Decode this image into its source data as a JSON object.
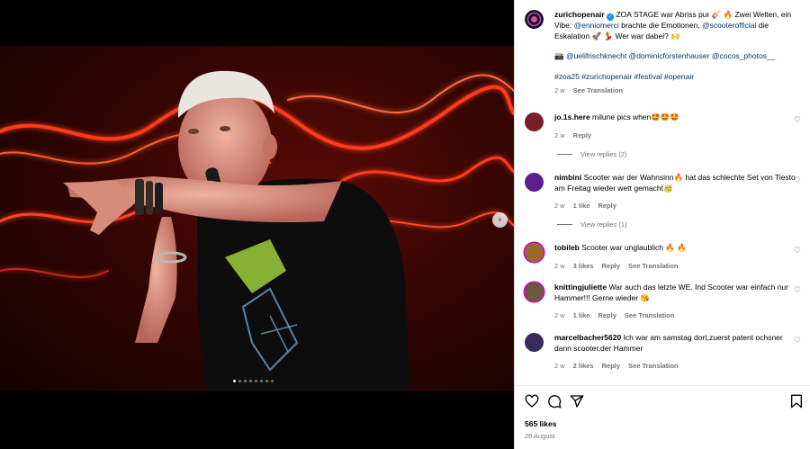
{
  "post": {
    "username": "zurichopenair",
    "verified_mark": "✓",
    "caption_parts": {
      "p1": " ZOA STAGE war Abriss pur 🎸 🔥 Zwei Welten, ein Vibe: ",
      "mention1": "@ennio​merci",
      "p2": " brachte die Emotionen, ",
      "mention2": "@scooterofficial",
      "p3": " die Eskalation 🚀 💃 Wer war dabei? 🙌"
    },
    "camera_line": "📸",
    "credits": [
      "@uelifrischknecht",
      "@dominicforstenhauser",
      "@cocos_photos__"
    ],
    "hashtags": [
      "#zoa25",
      "#zurichopenair",
      "#festival",
      "#openair"
    ],
    "time": "2 w",
    "see_translation": "See Translation"
  },
  "comments": [
    {
      "username": "jo.1s.here",
      "text": " milune pics when🤩🤩🤩",
      "time": "2 w",
      "likes": "",
      "reply": "Reply",
      "translation": "",
      "view_replies": "View replies (2)",
      "avatar_color": "#7a1d2a"
    },
    {
      "username": "nimbini",
      "text": " Scooter war der Wahnsinn🔥 hat das schlechte Set von Tiesto am Freitag wieder wett gemacht🥳",
      "time": "2 w",
      "likes": "1 like",
      "reply": "Reply",
      "translation": "",
      "view_replies": "View replies (1)",
      "avatar_color": "#5b1e8a"
    },
    {
      "username": "tobileb",
      "text": " Scooter war unglaublich 🔥 🔥",
      "time": "2 w",
      "likes": "3 likes",
      "reply": "Reply",
      "translation": "See Translation",
      "view_replies": "",
      "avatar_color": "#9a6a2c"
    },
    {
      "username": "knittingjuliette",
      "text": " War auch das letzte WE. Ind Scooter war einfach nur Hammer!!! Gerne wieder 😘",
      "time": "2 w",
      "likes": "1 like",
      "reply": "Reply",
      "translation": "See Translation",
      "view_replies": "",
      "avatar_color": "#6b5a3a"
    },
    {
      "username": "marcelbacher5620",
      "text": " Ich war am samstag dort,zuerst patent ochsner dann scooter,der Hammer",
      "time": "2 w",
      "likes": "2 likes",
      "reply": "Reply",
      "translation": "See Translation",
      "view_replies": "",
      "avatar_color": "#3a2b5c"
    }
  ],
  "footer": {
    "likes": "565 likes",
    "date": "26 August"
  },
  "icons": {
    "like": "heart-icon",
    "comment": "comment-icon",
    "share": "send-icon",
    "save": "bookmark-icon",
    "next": "chevron-right-icon"
  },
  "carousel": {
    "slides": 8,
    "active": 0
  }
}
